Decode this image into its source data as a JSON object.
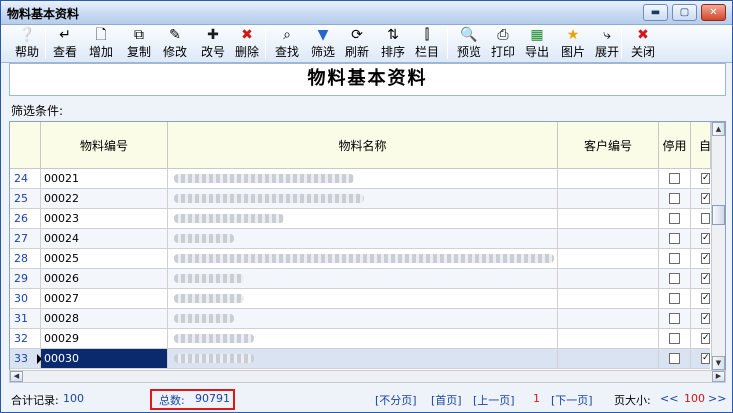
{
  "window": {
    "title": "物料基本资料",
    "minimize": "▬",
    "maximize": "▢",
    "close": "✕"
  },
  "toolbar": [
    {
      "label": "帮助",
      "icon": "help-icon",
      "glyph": "❔"
    },
    {
      "label": "查看",
      "icon": "enter-icon",
      "glyph": "↵"
    },
    {
      "label": "增加",
      "icon": "new-document-icon",
      "glyph": "🗋"
    },
    {
      "label": "复制",
      "icon": "copy-icon",
      "glyph": "⧉"
    },
    {
      "label": "修改",
      "icon": "edit-icon",
      "glyph": "✎"
    },
    {
      "label": "改号",
      "icon": "plus-icon",
      "glyph": "✚"
    },
    {
      "label": "删除",
      "icon": "delete-icon",
      "glyph": "✖"
    },
    {
      "label": "查找",
      "icon": "binoculars-icon",
      "glyph": "⌕"
    },
    {
      "label": "筛选",
      "icon": "filter-icon",
      "glyph": "▼"
    },
    {
      "label": "刷新",
      "icon": "refresh-icon",
      "glyph": "⟳"
    },
    {
      "label": "排序",
      "icon": "sort-icon",
      "glyph": "⇅"
    },
    {
      "label": "栏目",
      "icon": "columns-icon",
      "glyph": "⫿"
    },
    {
      "label": "预览",
      "icon": "preview-icon",
      "glyph": "🔍"
    },
    {
      "label": "打印",
      "icon": "print-icon",
      "glyph": "⎙"
    },
    {
      "label": "导出",
      "icon": "excel-icon",
      "glyph": "▦"
    },
    {
      "label": "图片",
      "icon": "star-icon",
      "glyph": "★"
    },
    {
      "label": "展开",
      "icon": "expand-icon",
      "glyph": "⤷"
    },
    {
      "label": "关闭",
      "icon": "close-icon",
      "glyph": "✖"
    }
  ],
  "caption": "物料基本资料",
  "filter_label": "筛选条件:",
  "grid": {
    "columns": [
      "物料编号",
      "物料名称",
      "客户编号",
      "停用",
      "自"
    ],
    "rows": [
      {
        "num": "24",
        "code": "00021",
        "stop": false,
        "self": true
      },
      {
        "num": "25",
        "code": "00022",
        "stop": false,
        "self": true
      },
      {
        "num": "26",
        "code": "00023",
        "stop": false,
        "self": false
      },
      {
        "num": "27",
        "code": "00024",
        "stop": false,
        "self": true
      },
      {
        "num": "28",
        "code": "00025",
        "stop": false,
        "self": true
      },
      {
        "num": "29",
        "code": "00026",
        "stop": false,
        "self": true
      },
      {
        "num": "30",
        "code": "00027",
        "stop": false,
        "self": true
      },
      {
        "num": "31",
        "code": "00028",
        "stop": false,
        "self": true
      },
      {
        "num": "32",
        "code": "00029",
        "stop": false,
        "self": true
      },
      {
        "num": "33",
        "code": "00030",
        "stop": false,
        "self": true
      }
    ],
    "selected_row": 9
  },
  "status": {
    "records_label": "合计记录:",
    "records_value": "100",
    "total_label": "总数:",
    "total_value": "90791",
    "no_paging": "[不分页]",
    "first_page": "[首页]",
    "prev_page": "[上一页]",
    "current_page": "1",
    "next_page": "[下一页]",
    "page_size_label": "页大小:",
    "page_size_value": "100",
    "dec": "<<",
    "inc": ">>"
  }
}
